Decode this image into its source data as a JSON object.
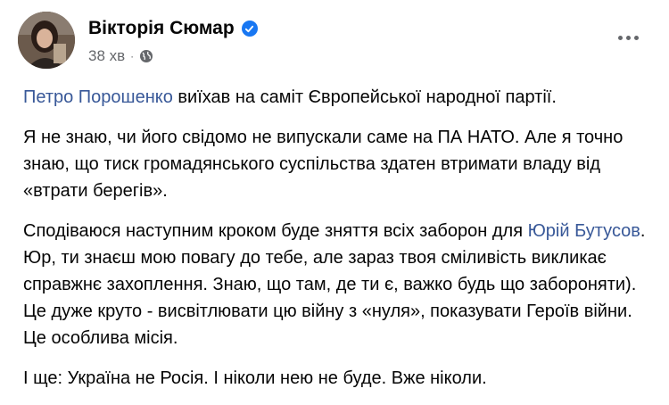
{
  "post": {
    "author": "Вікторія Сюмар",
    "time": "38 хв",
    "separator": "·",
    "icons": {
      "verified": "verified-badge-icon",
      "audience": "globe-icon",
      "more": "more-options-icon"
    },
    "colors": {
      "link": "#385898",
      "verified": "#1877f2",
      "meta": "#65676b"
    },
    "paragraphs": [
      {
        "mention": "Петро Порошенко",
        "text": " виїхав на саміт Європейської народної партії."
      },
      {
        "text": "Я не знаю, чи його свідомо не випускали саме на ПА НАТО. Але я точно знаю, що тиск громадянського суспільства здатен втримати владу від «втрати берегів»."
      },
      {
        "text_before": "Сподіваюся наступним кроком буде зняття всіх заборон для ",
        "mention": "Юрій Бутусов",
        "text_after": ". Юр, ти знаєш мою повагу до тебе, але зараз твоя сміливість викликає справжнє захоплення. Знаю, що там, де ти є, важко будь що забороняти). Це дуже круто - висвітлювати цю війну з «нуля», показувати Героїв війни. Це особлива місія."
      },
      {
        "text": "І ще: Україна не Росія. І ніколи нею не буде. Вже ніколи."
      }
    ]
  }
}
